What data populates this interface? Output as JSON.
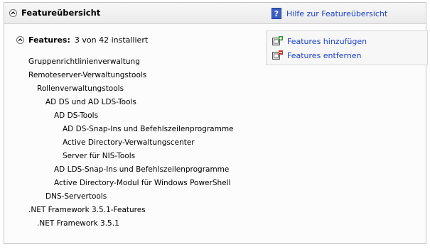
{
  "header": {
    "title": "Featureübersicht",
    "help_link": "Hilfe zur Featureübersicht"
  },
  "section": {
    "title": "Features:",
    "count": "3 von 42 installiert"
  },
  "actions": {
    "add": "Features hinzufügen",
    "remove": "Features entfernen"
  },
  "tree": [
    {
      "label": "Gruppenrichtlinienverwaltung",
      "level": 0
    },
    {
      "label": "Remoteserver-Verwaltungstools",
      "level": 0
    },
    {
      "label": "Rollenverwaltungstools",
      "level": 1
    },
    {
      "label": "AD DS und AD LDS-Tools",
      "level": 2
    },
    {
      "label": "AD DS-Tools",
      "level": 3
    },
    {
      "label": "AD DS-Snap-Ins und Befehlszeilenprogramme",
      "level": 4
    },
    {
      "label": "Active Directory-Verwaltungscenter",
      "level": 4
    },
    {
      "label": "Server für NIS-Tools",
      "level": 4
    },
    {
      "label": "AD LDS-Snap-Ins und Befehlszeilenprogramme",
      "level": 3
    },
    {
      "label": "Active Directory-Modul für Windows PowerShell",
      "level": 3
    },
    {
      "label": "DNS-Servertools",
      "level": 2
    },
    {
      "label": ".NET Framework 3.5.1-Features",
      "level": 0
    },
    {
      "label": ".NET Framework 3.5.1",
      "level": 1
    }
  ],
  "colors": {
    "link": "#1a3fc7",
    "header_bg": "#ebebeb",
    "help_icon": "#3b5fc8",
    "add_icon": "#2e9a2e",
    "remove_icon": "#c0392b"
  },
  "icons": {
    "collapse": "chevron-up-icon",
    "help": "help-icon",
    "add": "add-feature-icon",
    "remove": "remove-feature-icon"
  }
}
